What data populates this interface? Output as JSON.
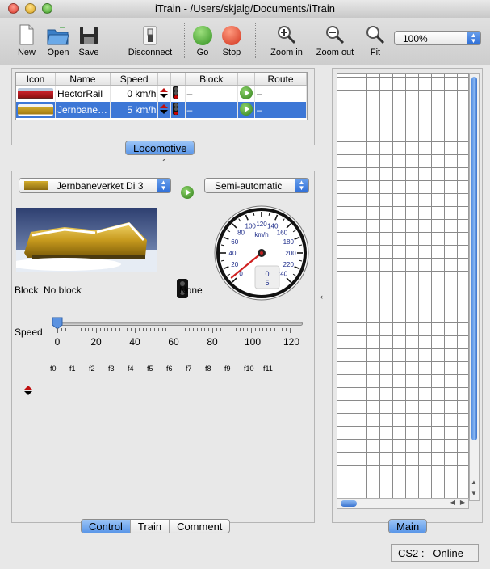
{
  "window": {
    "title": "iTrain - /Users/skjalg/Documents/iTrain"
  },
  "toolbar": {
    "new_label": "New",
    "open_label": "Open",
    "save_label": "Save",
    "disconnect_label": "Disconnect",
    "go_label": "Go",
    "stop_label": "Stop",
    "zoom_in_label": "Zoom in",
    "zoom_out_label": "Zoom out",
    "fit_label": "Fit",
    "zoom_value": "100%"
  },
  "loco_table": {
    "columns": [
      "Icon",
      "Name",
      "Speed",
      "Block",
      "Route"
    ],
    "rows": [
      {
        "name": "HectorRail",
        "speed": "0 km/h",
        "block": "–",
        "route": "–",
        "selected": false
      },
      {
        "name": "Jernbane…",
        "speed": "5 km/h",
        "block": "–",
        "route": "–",
        "selected": true
      }
    ],
    "tab_label": "Locomotive"
  },
  "control": {
    "loco_select": "Jernbaneverket Di 3",
    "mode_select": "Semi-automatic",
    "block_label": "Block",
    "block_value": "No block",
    "signal_value": "None",
    "speed_label": "Speed",
    "speed_value": 0,
    "speed_ticks": [
      "0",
      "20",
      "40",
      "60",
      "80",
      "100",
      "120"
    ],
    "functions": [
      "f0",
      "f1",
      "f2",
      "f3",
      "f4",
      "f5",
      "f6",
      "f7",
      "f8",
      "f9",
      "f10",
      "f11"
    ],
    "gauge": {
      "unit": "km/h",
      "ticks": [
        "0",
        "20",
        "40",
        "60",
        "80",
        "100",
        "120",
        "140",
        "160",
        "180",
        "200",
        "220",
        "240"
      ],
      "digital_top": "0",
      "digital_bottom": "5",
      "needle_value": 5
    },
    "tabs": [
      "Control",
      "Train",
      "Comment"
    ],
    "active_tab": "Control"
  },
  "right": {
    "tab_label": "Main"
  },
  "status": {
    "text": "CS2 :   Online"
  },
  "colors": {
    "accent": "#3d77d6",
    "go": "#2fa12f",
    "stop": "#d83a1f"
  }
}
